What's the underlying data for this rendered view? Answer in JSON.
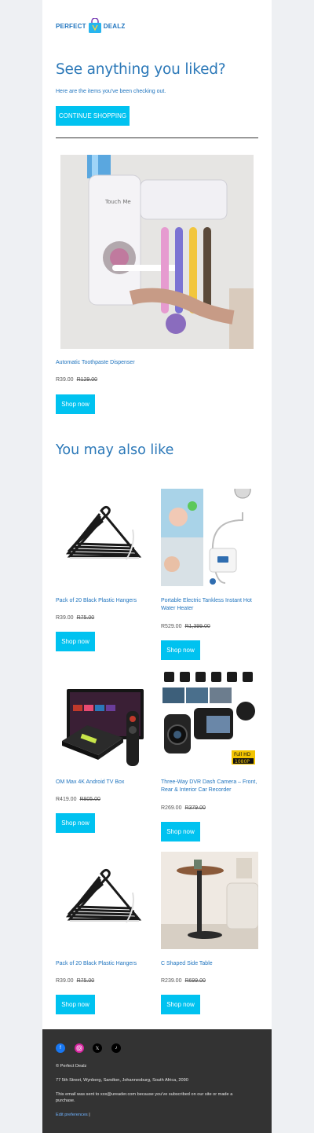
{
  "brand": {
    "part1": "PERFECT",
    "part2": "DEALZ"
  },
  "hero": {
    "headline": "See anything you liked?",
    "subtext": "Here are the items you've been checking out.",
    "cta": "CONTINUE SHOPPING"
  },
  "viewed": {
    "title": "Automatic Toothpaste Dispenser",
    "price": "R39.00",
    "old_price": "R129.00",
    "button": "Shop now",
    "image_text": "Touch Me"
  },
  "recommend": {
    "heading": "You may also like",
    "items": [
      {
        "title": "Pack of 20 Black Plastic Hangers",
        "price": "R39.00",
        "old_price": "R75.00",
        "button": "Shop now",
        "image": "hangers"
      },
      {
        "title": "Portable Electric Tankless Instant Hot Water Heater",
        "price": "R529.00",
        "old_price": "R1,399.00",
        "button": "Shop now",
        "image": "water-heater"
      },
      {
        "title": "OM Max 4K Android TV Box",
        "price": "R419.00",
        "old_price": "R805.00",
        "button": "Shop now",
        "image": "tv-box"
      },
      {
        "title": "Three-Way DVR Dash Camera – Front, Rear & Interior Car Recorder",
        "price": "R269.00",
        "old_price": "R379.00",
        "button": "Shop now",
        "image": "dash-cam"
      },
      {
        "title": "Pack of 20 Black Plastic Hangers",
        "price": "R39.00",
        "old_price": "R75.00",
        "button": "Shop now",
        "image": "hangers"
      },
      {
        "title": "C Shaped Side Table",
        "price": "R239.00",
        "old_price": "R699.00",
        "button": "Shop now",
        "image": "side-table"
      }
    ]
  },
  "footer": {
    "copyright": "© Perfect Dealz",
    "address": "77 5th Street, Wynberg, Sandton, Johannesburg, South Africa, 2090",
    "notice": "This email was sent to xxx@ureader.com because you've subscribed on our site or made a purchase.",
    "edit_link": "Edit preferences",
    "separator": "|",
    "social": [
      "facebook-icon",
      "instagram-icon",
      "x-icon",
      "tiktok-icon"
    ]
  },
  "colors": {
    "accent": "#00c2f0",
    "link": "#1e73be",
    "footer_bg": "#333333",
    "page_bg": "#eef0f3"
  }
}
